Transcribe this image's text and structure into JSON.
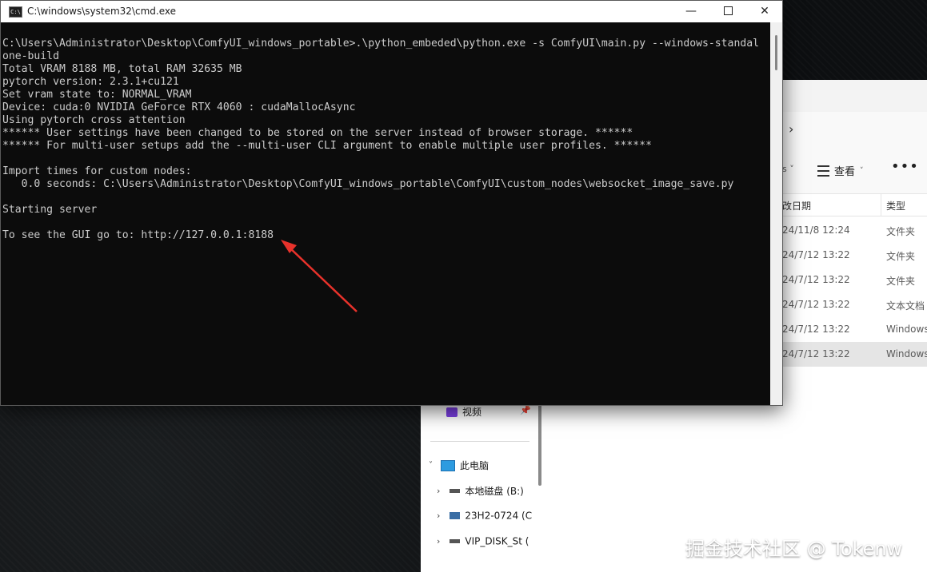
{
  "window": {
    "title": "C:\\windows\\system32\\cmd.exe",
    "icon_text": "C:\\"
  },
  "console": {
    "lines": [
      "C:\\Users\\Administrator\\Desktop\\ComfyUI_windows_portable>.\\python_embeded\\python.exe -s ComfyUI\\main.py --windows-standal",
      "one-build",
      "Total VRAM 8188 MB, total RAM 32635 MB",
      "pytorch version: 2.3.1+cu121",
      "Set vram state to: NORMAL_VRAM",
      "Device: cuda:0 NVIDIA GeForce RTX 4060 : cudaMallocAsync",
      "Using pytorch cross attention",
      "****** User settings have been changed to be stored on the server instead of browser storage. ******",
      "****** For multi-user setups add the --multi-user CLI argument to enable multiple user profiles. ******",
      "",
      "Import times for custom nodes:",
      "   0.0 seconds: C:\\Users\\Administrator\\Desktop\\ComfyUI_windows_portable\\ComfyUI\\custom_nodes\\websocket_image_save.py",
      "",
      "Starting server",
      "",
      "To see the GUI go to: http://127.0.0.1:8188"
    ]
  },
  "explorer": {
    "toolbar": {
      "sort_glyph": "s ˅",
      "view_label": "查看",
      "more_label": "•••",
      "nav_chevron": "›"
    },
    "columns": {
      "date": "改日期",
      "type": "类型"
    },
    "rows": [
      {
        "date": "24/11/8 12:24",
        "type": "文件夹"
      },
      {
        "date": "24/7/12 13:22",
        "type": "文件夹"
      },
      {
        "date": "24/7/12 13:22",
        "type": "文件夹"
      },
      {
        "date": "24/7/12 13:22",
        "type": "文本文档"
      },
      {
        "date": "24/7/12 13:22",
        "type": "Windows"
      },
      {
        "date": "24/7/12 13:22",
        "type": "Windows"
      }
    ],
    "sidebar": {
      "videos": "视频",
      "this_pc": "此电脑",
      "drive1": "本地磁盘 (B:)",
      "drive2": "23H2-0724 (C",
      "drive3": "VIP_DISK_St ("
    }
  },
  "watermark": "掘金技术社区 @ Tokenw",
  "colors": {
    "arrow": "#e8322b",
    "console_bg": "#0c0c0c",
    "console_text": "#cccccc"
  }
}
